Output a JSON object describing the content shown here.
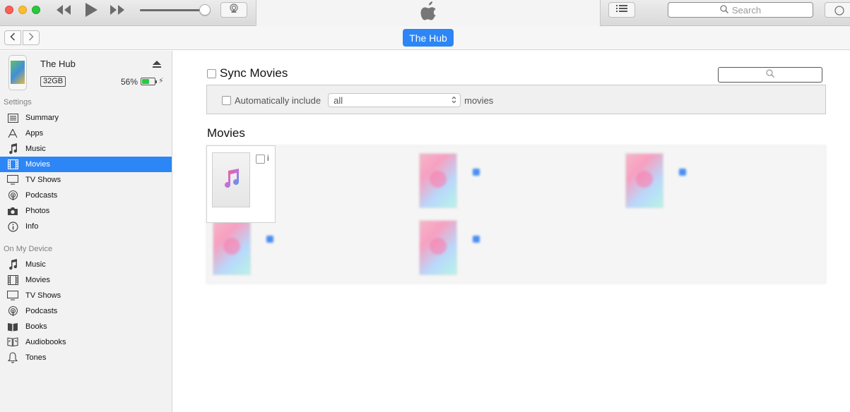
{
  "toolbar": {
    "search_placeholder": "Search"
  },
  "nav": {
    "device_label": "The Hub"
  },
  "device": {
    "name": "The Hub",
    "capacity": "32GB",
    "battery_text": "56%",
    "battery_level": 0.56,
    "battery_color": "#27c93f"
  },
  "sidebar": {
    "settings_header": "Settings",
    "settings_items": [
      {
        "label": "Summary",
        "icon": "list-icon"
      },
      {
        "label": "Apps",
        "icon": "apps-icon"
      },
      {
        "label": "Music",
        "icon": "music-note-icon"
      },
      {
        "label": "Movies",
        "icon": "film-icon",
        "active": true
      },
      {
        "label": "TV Shows",
        "icon": "tv-icon"
      },
      {
        "label": "Podcasts",
        "icon": "podcast-icon"
      },
      {
        "label": "Photos",
        "icon": "camera-icon"
      },
      {
        "label": "Info",
        "icon": "info-icon"
      }
    ],
    "device_header": "On My Device",
    "device_items": [
      {
        "label": "Music",
        "icon": "music-note-icon"
      },
      {
        "label": "Movies",
        "icon": "film-icon"
      },
      {
        "label": "TV Shows",
        "icon": "tv-icon"
      },
      {
        "label": "Podcasts",
        "icon": "podcast-icon"
      },
      {
        "label": "Books",
        "icon": "book-icon"
      },
      {
        "label": "Audiobooks",
        "icon": "audiobook-icon"
      },
      {
        "label": "Tones",
        "icon": "bell-icon"
      }
    ]
  },
  "main": {
    "sync_label": "Sync Movies",
    "auto_include_label": "Automatically include",
    "auto_include_value": "all",
    "auto_include_suffix": "movies",
    "movies_heading": "Movies",
    "first_tile_letter": "i"
  },
  "colors": {
    "accent": "#2c86f5",
    "sidebar_bg": "#f2f2f2"
  }
}
